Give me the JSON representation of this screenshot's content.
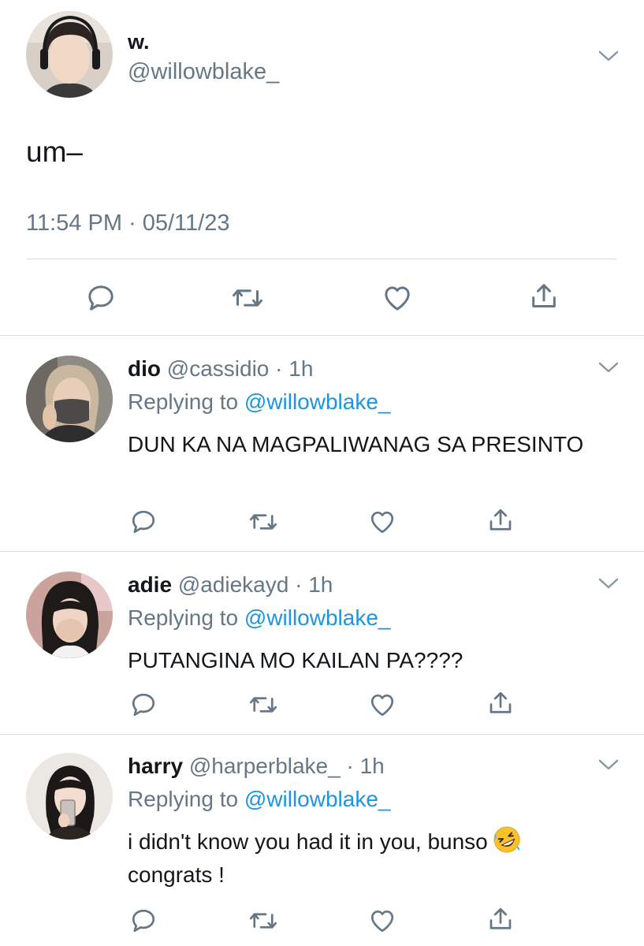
{
  "main_tweet": {
    "display_name": "w.",
    "handle": "@willowblake_",
    "text": "um–",
    "timestamp": "11:54 PM · 05/11/23"
  },
  "actions": [
    "reply-icon",
    "retweet-icon",
    "like-icon",
    "share-icon"
  ],
  "colors": {
    "text": "#14171a",
    "secondary": "#657786",
    "link": "#1b95e0",
    "divider": "#d9dde2",
    "icon": "#657786"
  },
  "reply_prefix": "Replying to",
  "replies": [
    {
      "display_name": "dio",
      "handle": "@cassidio",
      "time": "1h",
      "replying_to": "@willowblake_",
      "text": "DUN KA NA MAGPALIWANAG SA PRESINTO"
    },
    {
      "display_name": "adie",
      "handle": "@adiekayd",
      "time": "1h",
      "replying_to": "@willowblake_",
      "text": "PUTANGINA MO KAILAN PA????"
    },
    {
      "display_name": "harry",
      "handle": "@harperblake_",
      "time": "1h",
      "replying_to": "@willowblake_",
      "text": "i didn't know you had it in you, bunso",
      "emoji": "rolling-on-floor-laughing-emoji",
      "text_line2": "congrats !"
    }
  ]
}
